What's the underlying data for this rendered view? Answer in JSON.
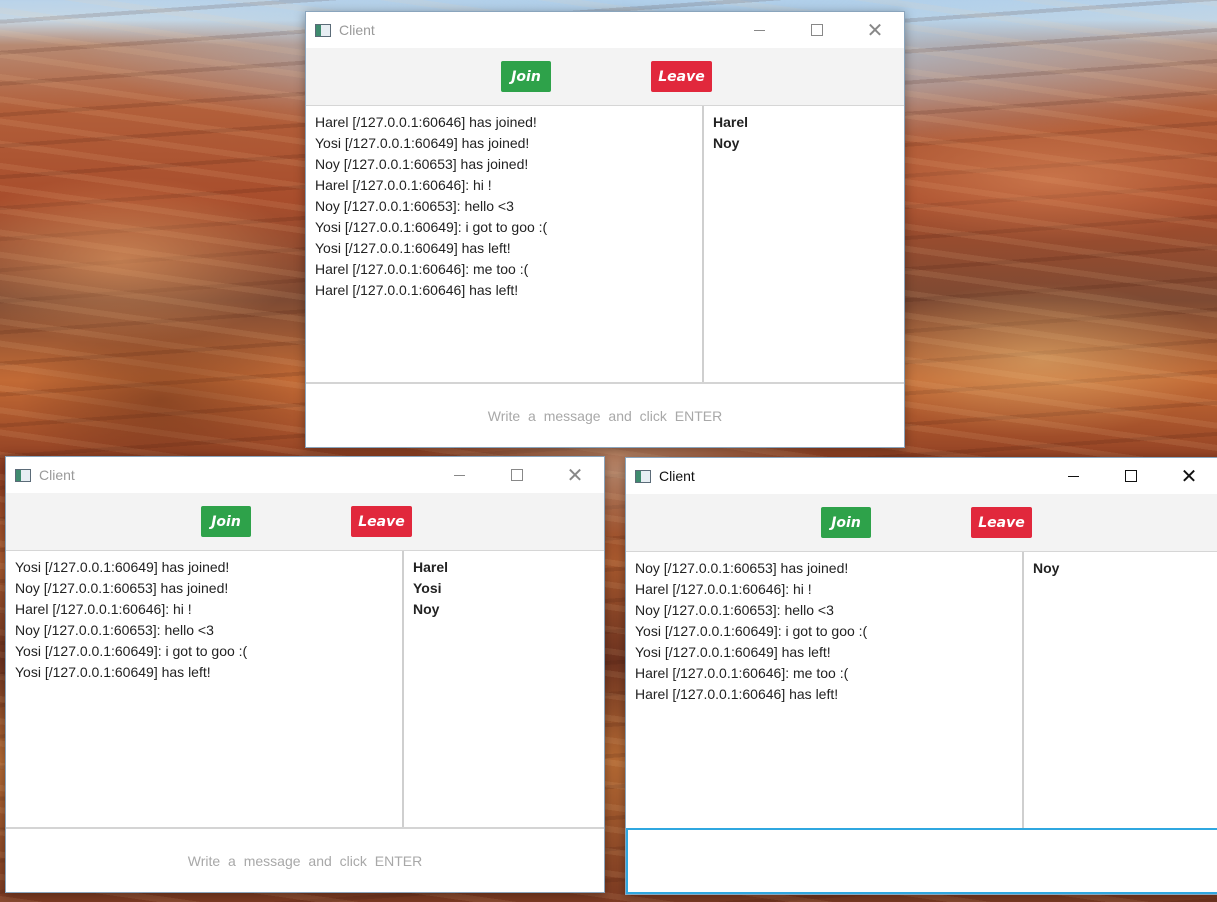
{
  "windows": {
    "top": {
      "title": "Client",
      "join_label": "Join",
      "leave_label": "Leave",
      "messages": [
        "Harel [/127.0.0.1:60646] has joined!",
        "Yosi [/127.0.0.1:60649] has joined!",
        "Noy [/127.0.0.1:60653] has joined!",
        "Harel [/127.0.0.1:60646]: hi !",
        "Noy [/127.0.0.1:60653]: hello <3",
        "Yosi [/127.0.0.1:60649]: i got to goo :(",
        "Yosi [/127.0.0.1:60649] has left!",
        "Harel [/127.0.0.1:60646]: me too :(",
        "Harel [/127.0.0.1:60646] has left!"
      ],
      "users": [
        "Harel",
        "Noy"
      ],
      "input_placeholder": "Write a message and click ENTER"
    },
    "bottom_left": {
      "title": "Client",
      "join_label": "Join",
      "leave_label": "Leave",
      "messages": [
        "Yosi [/127.0.0.1:60649] has joined!",
        "Noy [/127.0.0.1:60653] has joined!",
        "Harel [/127.0.0.1:60646]: hi !",
        "Noy [/127.0.0.1:60653]: hello <3",
        "Yosi [/127.0.0.1:60649]: i got to goo :(",
        "Yosi [/127.0.0.1:60649] has left!"
      ],
      "users": [
        "Harel",
        "Yosi",
        "Noy"
      ],
      "input_placeholder": "Write a message and click ENTER"
    },
    "bottom_right": {
      "title": "Client",
      "join_label": "Join",
      "leave_label": "Leave",
      "messages": [
        "Noy [/127.0.0.1:60653] has joined!",
        "Harel [/127.0.0.1:60646]: hi !",
        "Noy [/127.0.0.1:60653]: hello <3",
        "Yosi [/127.0.0.1:60649]: i got to goo :(",
        "Yosi [/127.0.0.1:60649] has left!",
        "Harel [/127.0.0.1:60646]: me too :(",
        "Harel [/127.0.0.1:60646] has left!"
      ],
      "users": [
        "Noy"
      ],
      "input_placeholder": ""
    }
  },
  "colors": {
    "join": "#2ea24a",
    "leave": "#e1283c",
    "focus_border": "#2fa7e0"
  }
}
